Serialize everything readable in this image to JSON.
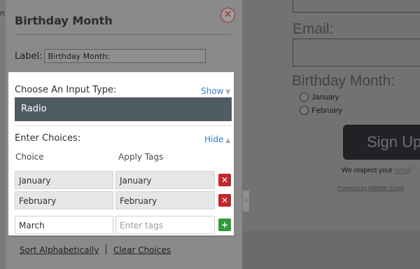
{
  "panel": {
    "title": "Birthday Month",
    "close_icon": "close-icon",
    "label_caption": "Label:",
    "label_value": "Birthday Month:"
  },
  "input_type": {
    "heading": "Choose An Input Type:",
    "toggle_label": "Show",
    "toggle_icon": "caret-down-icon",
    "selected": "Radio"
  },
  "choices": {
    "heading": "Enter Choices:",
    "toggle_label": "Hide",
    "toggle_icon": "caret-up-icon",
    "columns": [
      "Choice",
      "Apply Tags"
    ],
    "rows": [
      {
        "choice": "January",
        "tags": "January",
        "action_icon": "remove-icon"
      },
      {
        "choice": "February",
        "tags": "February",
        "action_icon": "remove-icon"
      }
    ],
    "new_row": {
      "choice_value": "March",
      "tags_placeholder": "Enter tags",
      "action_icon": "add-icon"
    }
  },
  "footer": {
    "sort_label": "Sort Alphabetically",
    "clear_label": "Clear Choices"
  },
  "preview": {
    "left_cut_text": "n",
    "email_label": "Email:",
    "birthday_label": "Birthday Month:",
    "radio_options": [
      "January",
      "February"
    ],
    "signup_label": "Sign Up",
    "respect_text": "We respect your ",
    "respect_link": "email",
    "powered_text": "Powered by AWeber Email"
  },
  "colors": {
    "select_bg": "#505c63",
    "link": "#3a7dc9",
    "remove": "#c1272d",
    "add": "#2f9b3a"
  }
}
